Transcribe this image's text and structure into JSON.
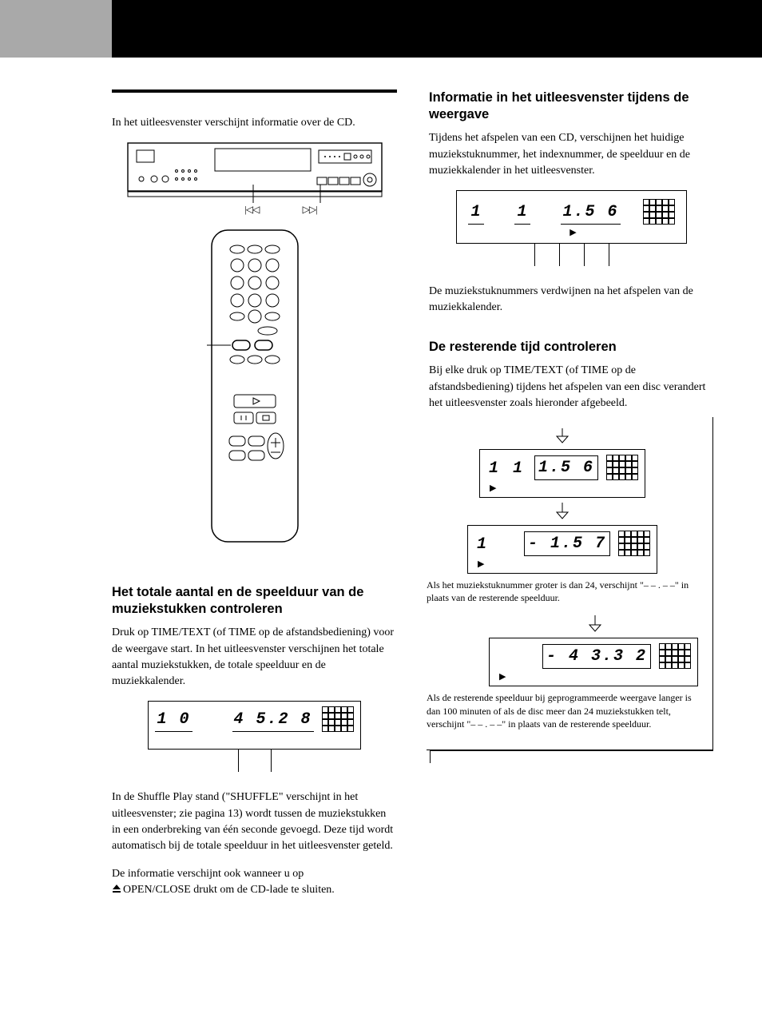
{
  "left": {
    "intro": "In het uitleesvenster verschijnt informatie over de CD.",
    "skip_prev": "⊲⊲",
    "skip_next": "⊳⊳",
    "h_total": "Het totale aantal en de speelduur van de muziekstukken controleren",
    "p_total": "Druk op TIME/TEXT (of TIME op de afstandsbediening) voor de weergave start. In het uitleesvenster verschijnen het totale aantal muziekstukken, de totale speelduur en de muziekkalender.",
    "lcd_total_tracks": "1 0",
    "lcd_total_time": "4 5.2 8",
    "p_shuffle": "In de Shuffle Play stand (\"SHUFFLE\" verschijnt in het uitleesvenster; zie pagina 13) wordt tussen de muziekstukken in een onderbreking van één seconde gevoegd. Deze tijd wordt automatisch bij de totale speelduur in het uitleesvenster geteld.",
    "p_openclose_a": "De informatie verschijnt ook wanneer u op",
    "p_openclose_b": "OPEN/CLOSE drukt om de CD-lade te sluiten."
  },
  "right": {
    "h_info": "Informatie in het uitleesvenster tijdens de weergave",
    "p_info": "Tijdens het afspelen van een CD, verschijnen het huidige muziekstuknummer, het indexnummer, de speelduur en de muziekkalender in het uitleesvenster.",
    "lcd_play_track": "1",
    "lcd_play_index": "1",
    "lcd_play_time": "1.5 6",
    "p_disappear": "De muziekstuknummers verdwijnen na het afspelen van de muziekkalender.",
    "h_remaining": "De resterende tijd controleren",
    "p_remaining": "Bij elke druk op TIME/TEXT (of TIME op de afstandsbediening) tijdens het afspelen van een disc verandert het uitleesvenster zoals hieronder afgebeeld.",
    "lcd_r1_track": "1",
    "lcd_r1_index": "1",
    "lcd_r1_time": "1.5 6",
    "note1": "Als het muziekstuknummer groter is dan 24, verschijnt \"– – . – –\" in plaats van de resterende speelduur.",
    "lcd_r2_track": "1",
    "lcd_r2_time": "- 1.5 7",
    "lcd_r3_time": "- 4 3.3 2",
    "note2": "Als de resterende speelduur bij geprogrammeerde weergave langer is dan 100 minuten of als de disc meer dan 24 muziekstukken telt, verschijnt \"– – . – –\" in plaats van de resterende speelduur."
  }
}
